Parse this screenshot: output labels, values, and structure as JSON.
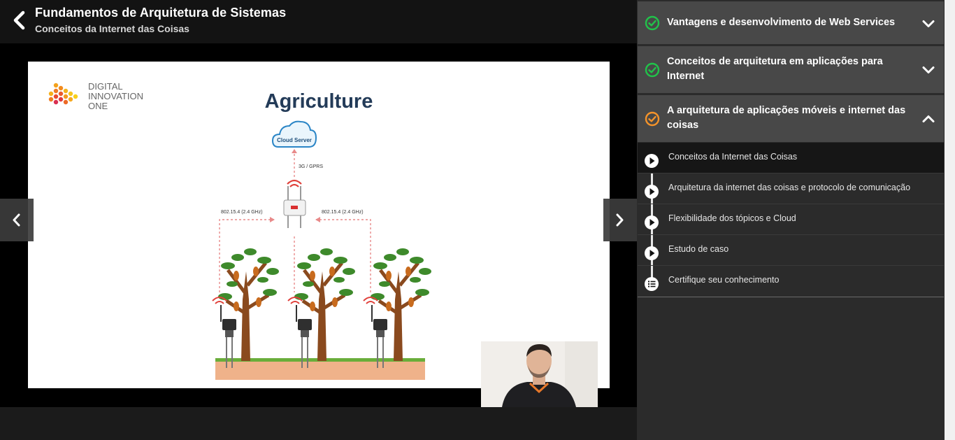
{
  "header": {
    "course_title": "Fundamentos de Arquitetura de Sistemas",
    "lesson_title": "Conceitos da Internet das Coisas"
  },
  "slide": {
    "logo_line1": "DIGITAL",
    "logo_line2": "INNOVATION",
    "logo_line3": "ONE",
    "heading": "Agriculture",
    "cloud_label": "Cloud Server",
    "uplink_label": "3G / GPRS",
    "left_link_label": "802.15.4 (2.4 GHz)",
    "right_link_label": "802.15.4 (2.4 GHz)"
  },
  "sidebar": {
    "modules": [
      {
        "title": "Vantagens e desenvolvimento de Web Services",
        "status": "completed",
        "status_icon": "check-circle-icon",
        "status_color": "#21c24a",
        "expanded": false
      },
      {
        "title": "Conceitos de arquitetura em aplicações para Internet",
        "status": "completed",
        "status_icon": "check-circle-icon",
        "status_color": "#21c24a",
        "expanded": false
      },
      {
        "title": "A arquitetura de aplicações móveis e internet das coisas",
        "status": "in-progress",
        "status_icon": "check-circle-icon",
        "status_color": "#f4932a",
        "expanded": true
      }
    ],
    "lessons": [
      {
        "label": "Conceitos da Internet das Coisas",
        "icon": "play-icon",
        "active": true
      },
      {
        "label": "Arquitetura da internet das coisas e protocolo de comunicação",
        "icon": "play-icon",
        "active": false
      },
      {
        "label": "Flexibilidade dos tópicos e Cloud",
        "icon": "play-icon",
        "active": false
      },
      {
        "label": "Estudo de caso",
        "icon": "play-icon",
        "active": false
      },
      {
        "label": "Certifique seu conhecimento",
        "icon": "list-icon",
        "active": false
      }
    ]
  },
  "colors": {
    "completed": "#21c24a",
    "in_progress": "#f4932a",
    "module_bg": "#484848",
    "brand_orange": "#e8782a"
  }
}
